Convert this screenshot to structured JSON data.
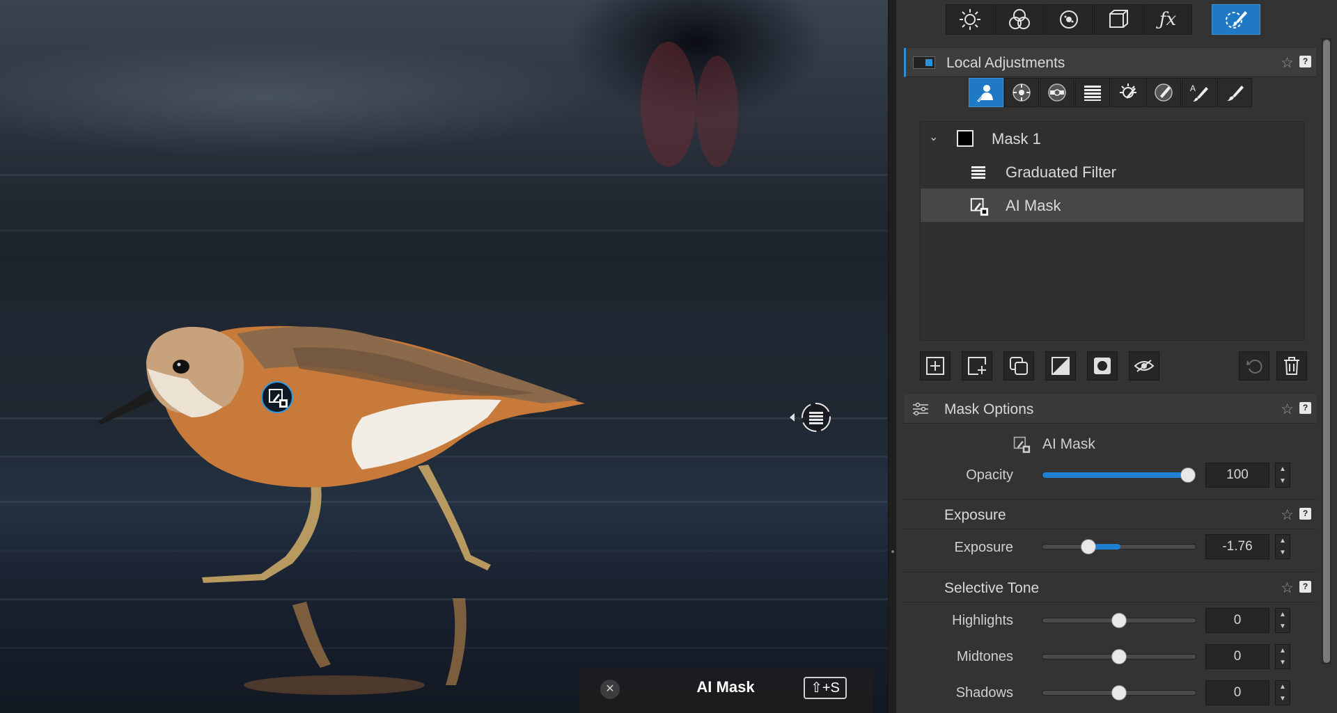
{
  "viewer": {
    "hud": {
      "close_glyph": "✕",
      "title": "AI Mask",
      "shortcut": "⇧+S"
    }
  },
  "panel": {
    "top_tabs": [
      {
        "icon": "sun-icon"
      },
      {
        "icon": "color-circles-icon"
      },
      {
        "icon": "detail-dots-icon"
      },
      {
        "icon": "geometry-cube-icon"
      },
      {
        "icon": "fx-icon",
        "label": "ƒx"
      },
      {
        "icon": "local-brush-icon",
        "active": true
      }
    ],
    "local_adjustments": {
      "title": "Local Adjustments",
      "star": "☆",
      "help": "?",
      "tools": [
        {
          "icon": "ai-mask-tool-icon",
          "active": true
        },
        {
          "icon": "control-point-icon"
        },
        {
          "icon": "control-line-icon"
        },
        {
          "icon": "graduated-filter-icon"
        },
        {
          "icon": "auto-mask-icon"
        },
        {
          "icon": "eraser-icon"
        },
        {
          "icon": "auto-brush-icon"
        },
        {
          "icon": "brush-icon"
        }
      ],
      "masks": [
        {
          "label": "Mask 1",
          "expanded": true
        },
        {
          "label": "Graduated Filter",
          "icon": "graduated-filter-icon"
        },
        {
          "label": "AI Mask",
          "icon": "ai-mask-icon",
          "selected": true
        }
      ]
    },
    "mask_options": {
      "title": "Mask Options",
      "tool_label": "AI Mask",
      "opacity_label": "Opacity",
      "opacity_value": "100",
      "opacity_level": 1.0
    },
    "exposure": {
      "title": "Exposure",
      "label": "Exposure",
      "value": "-1.76",
      "level": 0.3
    },
    "selective_tone": {
      "title": "Selective Tone",
      "sliders": [
        {
          "label": "Highlights",
          "value": "0",
          "level": 0.5
        },
        {
          "label": "Midtones",
          "value": "0",
          "level": 0.5
        },
        {
          "label": "Shadows",
          "value": "0",
          "level": 0.5
        }
      ]
    },
    "colors": {
      "accent": "#1f79c4",
      "panel_bg": "#333333"
    }
  }
}
